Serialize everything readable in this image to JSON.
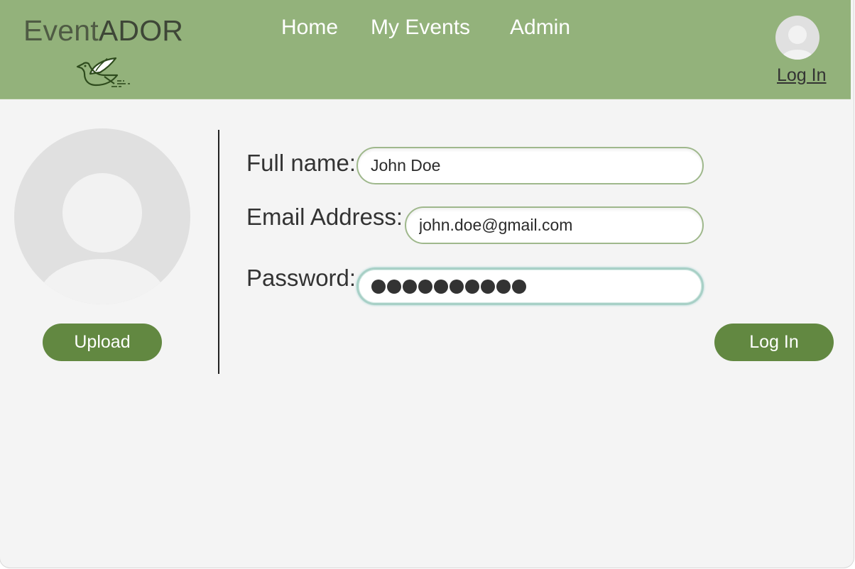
{
  "brand": {
    "name_part1": "Event",
    "name_part2": "ADOR",
    "logo_icon": "bird-icon"
  },
  "nav": {
    "items": [
      {
        "label": "Home"
      },
      {
        "label": "My Events"
      },
      {
        "label": "Admin"
      }
    ]
  },
  "header": {
    "avatar_icon": "user-avatar-icon",
    "login_link": "Log In"
  },
  "profile": {
    "avatar_icon": "user-avatar-icon",
    "upload_label": "Upload"
  },
  "form": {
    "full_name": {
      "label": "Full name:",
      "value": "John Doe"
    },
    "email": {
      "label": "Email Address:",
      "value": "john.doe@gmail.com"
    },
    "password": {
      "label": "Password:",
      "masked_length": 10
    },
    "login_button": "Log In"
  },
  "colors": {
    "header_bg": "#93b27b",
    "button_bg": "#628841",
    "page_bg": "#f4f4f4",
    "field_border": "#9fb88c",
    "focus_border": "#a8d0c6"
  }
}
